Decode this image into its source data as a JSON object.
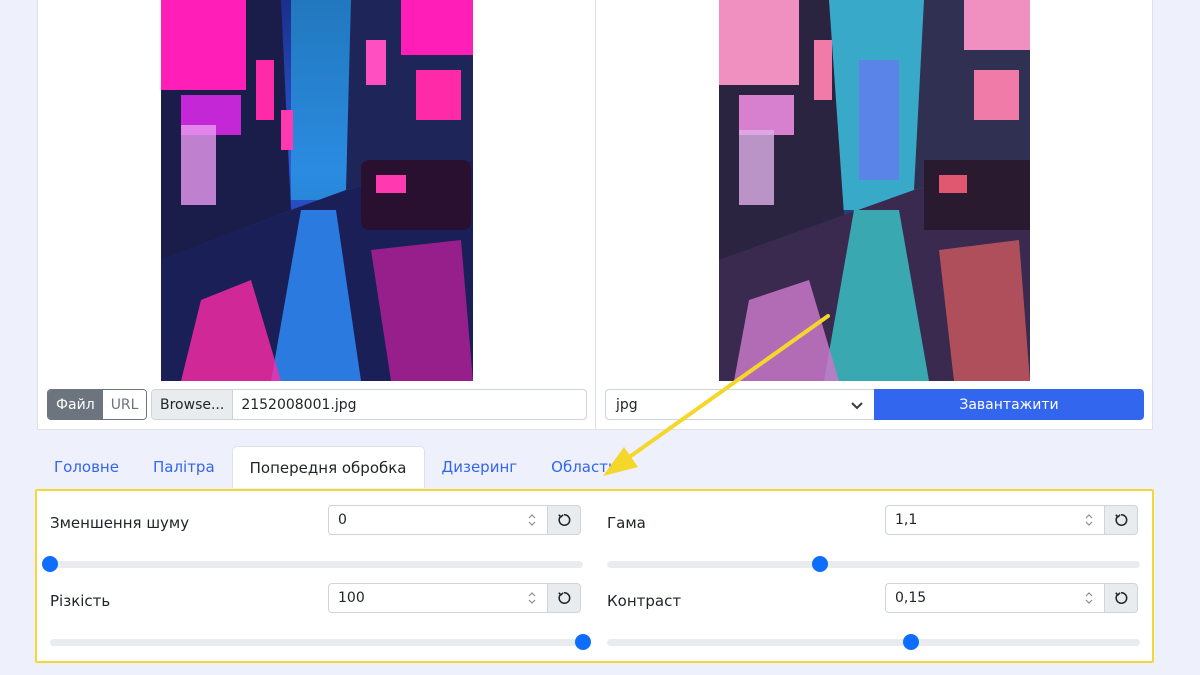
{
  "upload": {
    "file_tab": "Файл",
    "url_tab": "URL",
    "browse_label": "Browse...",
    "file_name": "2152008001.jpg"
  },
  "output": {
    "format": "jpg",
    "download_label": "Завантажити"
  },
  "tabs": [
    {
      "label": "Головне",
      "active": false
    },
    {
      "label": "Палітра",
      "active": false
    },
    {
      "label": "Попередня обробка",
      "active": true
    },
    {
      "label": "Дизеринг",
      "active": false
    },
    {
      "label": "Область",
      "active": false
    }
  ],
  "preprocessing": {
    "noise": {
      "label": "Зменшення шуму",
      "value": "0",
      "slider": 0
    },
    "sharpness": {
      "label": "Різкість",
      "value": "100",
      "slider": 1
    },
    "gamma": {
      "label": "Гама",
      "value": "1,1",
      "slider": 0.4
    },
    "contrast": {
      "label": "Контраст",
      "value": "0,15",
      "slider": 0.57
    }
  },
  "colors": {
    "accent": "#3366ee",
    "highlight": "#f2d63a",
    "slider": "#0d6efd"
  },
  "icons": {
    "reset": "reset-icon",
    "chevron": "chevron-down-icon",
    "spinner": "spinner-icon"
  }
}
